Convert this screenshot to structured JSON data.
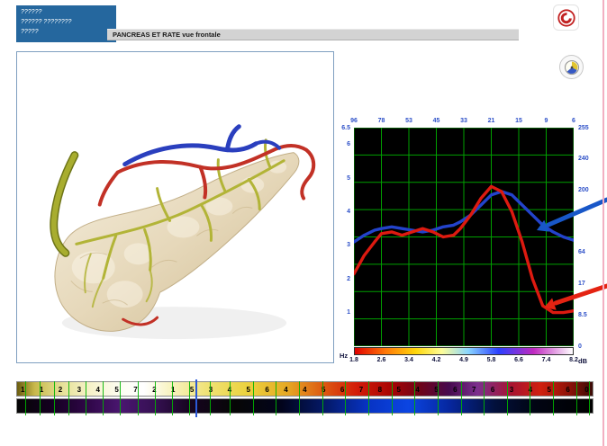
{
  "window": {
    "patient_box_lines": [
      "??????",
      "?????? ????????",
      "?????"
    ],
    "title_bar": "PANCREAS ET RATE vue frontale"
  },
  "icons": {
    "close_button": "record-stop-icon",
    "settings_button": "dial-icon"
  },
  "theme": {
    "arrow_blue": "#1857c8",
    "arrow_red": "#e42312",
    "cursor_blue": "#2b59d8",
    "grid_green": "#00a000"
  },
  "chart_data": {
    "type": "line",
    "title": "",
    "x_unit_label": "Hz",
    "right_unit_label": "dB",
    "top_axis_labels": [
      "96",
      "78",
      "53",
      "45",
      "33",
      "21",
      "15",
      "9",
      "6"
    ],
    "left_axis_labels": [
      "6.5",
      "6",
      "5",
      "4",
      "3",
      "2",
      "1"
    ],
    "right_axis_labels": [
      "255",
      "240",
      "200",
      "",
      "64",
      "17",
      "8.5",
      "0"
    ],
    "bottom_axis_labels": [
      "1.8",
      "2.6",
      "3.4",
      "4.2",
      "4.9",
      "5.8",
      "6.6",
      "7.4",
      "8.2"
    ],
    "x_range": [
      1.8,
      8.2
    ],
    "y_range": [
      0,
      6.5
    ],
    "grid": {
      "rows": 8,
      "cols": 8,
      "color": "#00a000",
      "bg": "#000000"
    },
    "x": [
      1.8,
      2.1,
      2.4,
      2.6,
      2.9,
      3.2,
      3.5,
      3.8,
      4.1,
      4.4,
      4.7,
      4.9,
      5.2,
      5.5,
      5.8,
      6.1,
      6.4,
      6.7,
      7.0,
      7.3,
      7.6,
      7.9,
      8.2
    ],
    "series": [
      {
        "name": "blue-curve",
        "color": "#2343cc",
        "values": [
          3.1,
          3.3,
          3.45,
          3.5,
          3.55,
          3.5,
          3.45,
          3.4,
          3.45,
          3.55,
          3.6,
          3.7,
          3.9,
          4.2,
          4.5,
          4.6,
          4.5,
          4.2,
          3.9,
          3.6,
          3.4,
          3.25,
          3.15
        ]
      },
      {
        "name": "red-curve",
        "color": "#dd1a10",
        "values": [
          2.15,
          2.7,
          3.1,
          3.35,
          3.4,
          3.3,
          3.4,
          3.5,
          3.4,
          3.25,
          3.3,
          3.5,
          3.9,
          4.4,
          4.75,
          4.6,
          4.0,
          3.1,
          2.0,
          1.2,
          1.0,
          1.0,
          1.05
        ]
      }
    ],
    "colorbar_stops": [
      "#e00000 0%",
      "#ff7708 14%",
      "#ffd70a 28%",
      "#fdfd9a 40%",
      "#8ad6ff 52%",
      "#2a3fff 66%",
      "#c02ac0 82%",
      "#ffffff 100%"
    ],
    "legend_position": "none"
  },
  "timeline": {
    "numbers": [
      "1",
      "1",
      "2",
      "3",
      "4",
      "5",
      "7",
      "2",
      "1",
      "5",
      "3",
      "4",
      "5",
      "6",
      "4",
      "4",
      "5",
      "6",
      "7",
      "8",
      "5",
      "4",
      "5",
      "6",
      "7",
      "6",
      "3",
      "4",
      "5",
      "6",
      "0"
    ],
    "cursor_pos_pct": 31,
    "tick_positions_pct": [
      1.5,
      4,
      6.5,
      9,
      12,
      15,
      18,
      21,
      24,
      27,
      30,
      33.5,
      37,
      41,
      45,
      49,
      53,
      57,
      61,
      65,
      69,
      73,
      77,
      81,
      85,
      89,
      93,
      97,
      99.2
    ],
    "strip1_gradient": [
      "#6b5d10 0%",
      "#c8b84a 3%",
      "#e7e29a 8%",
      "#f7f3cc 13%",
      "#fdfdf2 18%",
      "#ffffff 22%",
      "#f7f2bc 27%",
      "#f0e276 33%",
      "#ecd23e 40%",
      "#e6a824 47%",
      "#dd5c12 53%",
      "#d31c08 59%",
      "#a80404 65%",
      "#6e0418 70%",
      "#46094e 75%",
      "#7c2f8e 80%",
      "#a81430 86%",
      "#d0200f 91%",
      "#8c1208 96%",
      "#3a0a06 100%"
    ],
    "strip2_gradient": [
      "#050505 0%",
      "#140020 6%",
      "#2e0646 12%",
      "#4a1670 18%",
      "#351052 24%",
      "#16041f 30%",
      "#060606 38%",
      "#02041c 46%",
      "#041b6e 54%",
      "#0733c4 61%",
      "#0b45e2 68%",
      "#0627a0 75%",
      "#02103c 83%",
      "#010513 90%",
      "#000000 100%"
    ]
  }
}
